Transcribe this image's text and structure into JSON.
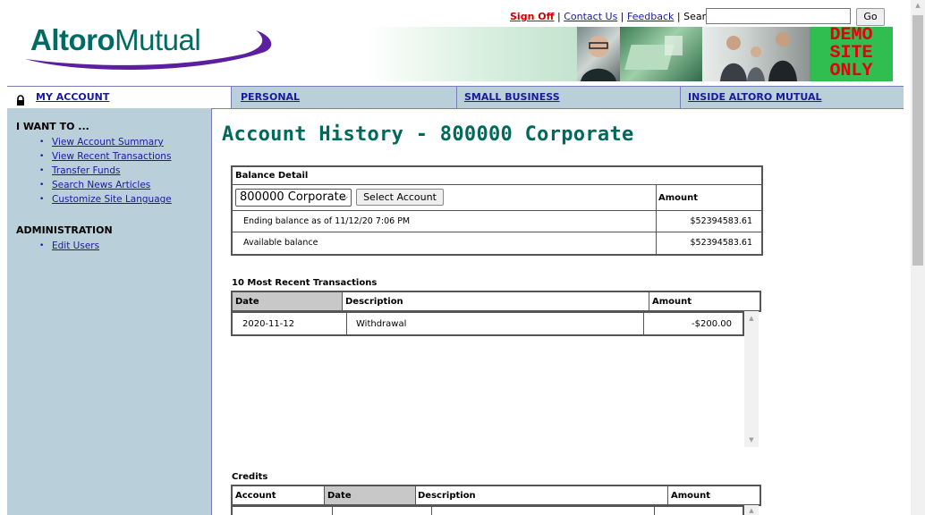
{
  "brand": {
    "logo_part1": "Altoro",
    "logo_part2": "Mutual"
  },
  "toplinks": {
    "sign_off": "Sign Off",
    "contact_us": "Contact Us",
    "feedback": "Feedback",
    "search_label": "Search",
    "sep": "|",
    "go": "Go"
  },
  "banner": {
    "demo_text": "DEMO SITE ONLY"
  },
  "nav": {
    "my_account": "MY ACCOUNT",
    "personal": "PERSONAL",
    "small_business": "SMALL BUSINESS",
    "inside": "INSIDE ALTORO MUTUAL"
  },
  "sidebar": {
    "i_want_to": "I WANT TO ...",
    "links": [
      "View Account Summary",
      "View Recent Transactions",
      "Transfer Funds",
      "Search News Articles",
      "Customize Site Language"
    ],
    "administration": "ADMINISTRATION",
    "admin_links": [
      "Edit Users"
    ]
  },
  "main": {
    "title": "Account History - 800000 Corporate",
    "balance": {
      "header": "Balance Detail",
      "selected_account": "800000 Corporate",
      "select_button": "Select Account",
      "amount_header": "Amount",
      "rows": [
        {
          "label": "Ending balance as of 11/12/20 7:06 PM",
          "amount": "$52394583.61"
        },
        {
          "label": "Available balance",
          "amount": "$52394583.61"
        }
      ]
    },
    "recent": {
      "title": "10 Most Recent Transactions",
      "headers": [
        "Date",
        "Description",
        "Amount"
      ],
      "rows": [
        {
          "date": "2020-11-12",
          "description": "Withdrawal",
          "amount": "-$200.00"
        }
      ]
    },
    "credits": {
      "title": "Credits",
      "headers": [
        "Account",
        "Date",
        "Description",
        "Amount"
      ]
    }
  },
  "colors": {
    "accent": "#00695c",
    "nav_bg": "#b9cfd9",
    "demo_bg": "#2fbe4f",
    "demo_text": "#e4000f",
    "link": "#1a1a9c",
    "signoff": "#cc0000"
  }
}
